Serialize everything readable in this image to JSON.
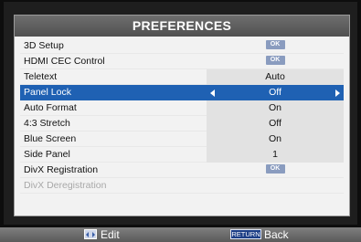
{
  "dialog": {
    "title": "PREFERENCES"
  },
  "rows": [
    {
      "label": "3D Setup",
      "value": "OK",
      "type": "button"
    },
    {
      "label": "HDMI CEC Control",
      "value": "OK",
      "type": "button"
    },
    {
      "label": "Teletext",
      "value": "Auto",
      "type": "value"
    },
    {
      "label": "Panel Lock",
      "value": "Off",
      "type": "selector",
      "selected": true
    },
    {
      "label": "Auto Format",
      "value": "On",
      "type": "value"
    },
    {
      "label": "4:3 Stretch",
      "value": "Off",
      "type": "value"
    },
    {
      "label": "Blue Screen",
      "value": "On",
      "type": "value"
    },
    {
      "label": "Side Panel",
      "value": "1",
      "type": "value"
    },
    {
      "label": "DivX Registration",
      "value": "OK",
      "type": "button"
    },
    {
      "label": "DivX Deregistration",
      "value": "",
      "type": "disabled"
    }
  ],
  "footer": {
    "edit_label": "Edit",
    "return_key": "RETURN",
    "back_label": "Back"
  },
  "colors": {
    "selected_row": "#1f61b3",
    "title_bar": "#5f5f5f",
    "ok_badge": "#8a9cbf"
  },
  "icons": {
    "edit": "left-right-arrows-icon",
    "selector_left": "arrow-left-icon",
    "selector_right": "arrow-right-icon"
  }
}
